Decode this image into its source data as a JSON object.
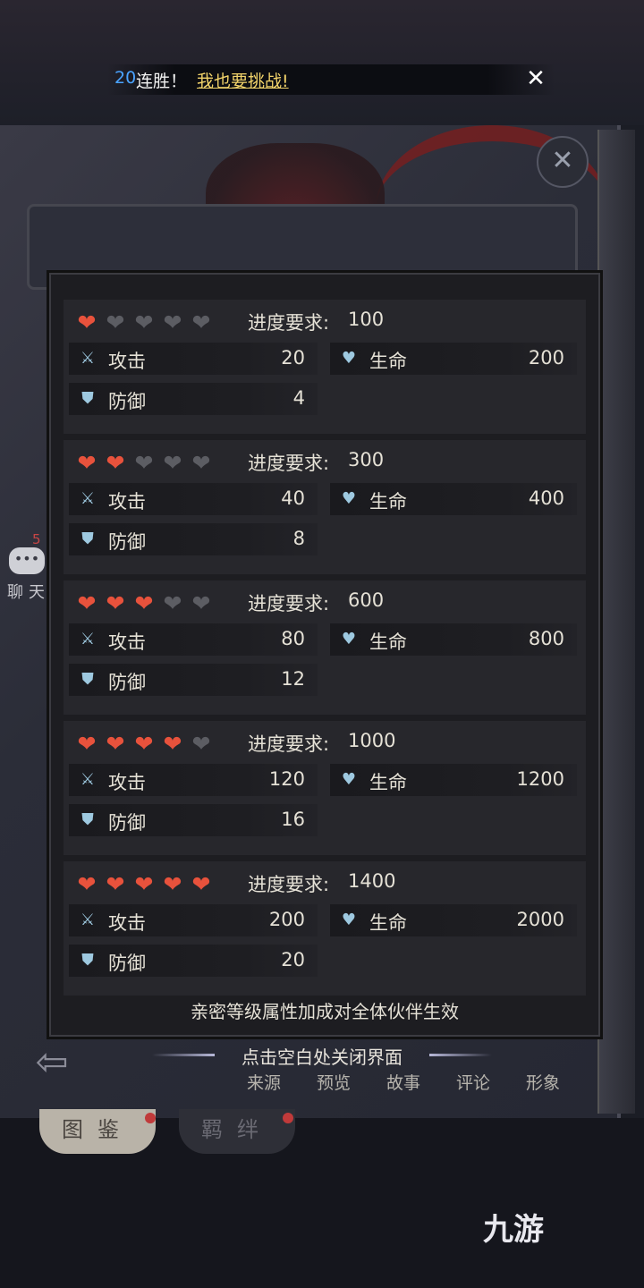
{
  "notice": {
    "streak_count": "20",
    "streak_text": "连胜！",
    "challenge_link": "我也要挑战!",
    "close_icon": "close-icon"
  },
  "chat": {
    "badge": "5",
    "label": "聊天"
  },
  "panel": {
    "requirement_label": "进度要求:",
    "attack_label": "攻击",
    "hp_label": "生命",
    "defense_label": "防御",
    "footer": "亲密等级属性加成对全体伙伴生效",
    "tiers": [
      {
        "hearts": 1,
        "requirement": "100",
        "attack": "20",
        "hp": "200",
        "defense": "4"
      },
      {
        "hearts": 2,
        "requirement": "300",
        "attack": "40",
        "hp": "400",
        "defense": "8"
      },
      {
        "hearts": 3,
        "requirement": "600",
        "attack": "80",
        "hp": "800",
        "defense": "12"
      },
      {
        "hearts": 4,
        "requirement": "1000",
        "attack": "120",
        "hp": "1200",
        "defense": "16"
      },
      {
        "hearts": 5,
        "requirement": "1400",
        "attack": "200",
        "hp": "2000",
        "defense": "20"
      }
    ]
  },
  "close_hint": "点击空白处关闭界面",
  "tabs": [
    "来源",
    "预览",
    "故事",
    "评论",
    "形象"
  ],
  "bookmarks": [
    "图鉴",
    "羁绊"
  ],
  "logo": "九游",
  "colors": {
    "heart_on": "#e8523c",
    "heart_off": "#5c5d63",
    "link": "#f2d36a",
    "streak": "#4aa3ff"
  }
}
